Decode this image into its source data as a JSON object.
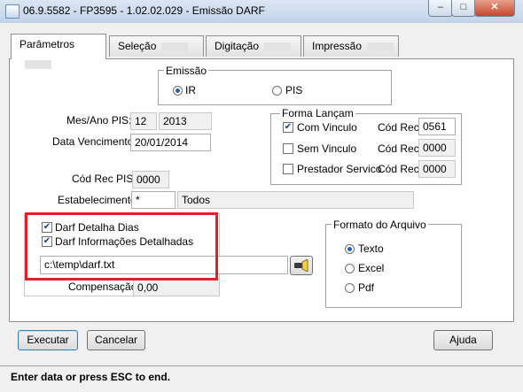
{
  "window": {
    "title": "06.9.5582 - FP3595 - 1.02.02.029 - Emissão DARF"
  },
  "tabs": [
    {
      "label": "Parâmetros",
      "active": true
    },
    {
      "label": "Seleção"
    },
    {
      "label": "Digitação"
    },
    {
      "label": "Impressão"
    }
  ],
  "emissao": {
    "legend": "Emissão",
    "options": [
      {
        "label": "IR",
        "selected": true
      },
      {
        "label": "PIS",
        "selected": false
      }
    ]
  },
  "mes_ano_pis": {
    "label": "Mes/Ano PIS:",
    "month": "12",
    "year": "2013"
  },
  "data_vencimento": {
    "label": "Data Vencimento:",
    "value": "20/01/2014"
  },
  "cod_rec_pis": {
    "label": "Cód Rec PIS:",
    "value": "0000"
  },
  "estabelecimento": {
    "label": "Estabelecimento:",
    "code": "*",
    "description": "Todos"
  },
  "forma_lancam": {
    "legend": "Forma Lançam",
    "rows": [
      {
        "label": "Com Vinculo",
        "checked": true,
        "cod_label": "Cód Rec:",
        "cod_value": "0561",
        "editable": true
      },
      {
        "label": "Sem Vinculo",
        "checked": false,
        "cod_label": "Cód Rec:",
        "cod_value": "0000",
        "editable": false
      },
      {
        "label": "Prestador Servico",
        "checked": false,
        "cod_label": "Cód Rec:",
        "cod_value": "0000",
        "editable": false
      }
    ]
  },
  "darf_options": [
    {
      "label": "Darf Detalha Dias",
      "checked": true
    },
    {
      "label": "Darf Informações Detalhadas",
      "checked": true
    }
  ],
  "file_path": "c:\\temp\\darf.txt",
  "compensacao": {
    "label": "Compensação:",
    "value": "0,00"
  },
  "formato_arquivo": {
    "legend": "Formato do Arquivo",
    "options": [
      {
        "label": "Texto",
        "selected": true
      },
      {
        "label": "Excel",
        "selected": false
      },
      {
        "label": "Pdf",
        "selected": false
      }
    ]
  },
  "buttons": {
    "executar": "Executar",
    "cancelar": "Cancelar",
    "ajuda": "Ajuda"
  },
  "status": "Enter data or press ESC to end.",
  "highlight_color": "#e3202a"
}
